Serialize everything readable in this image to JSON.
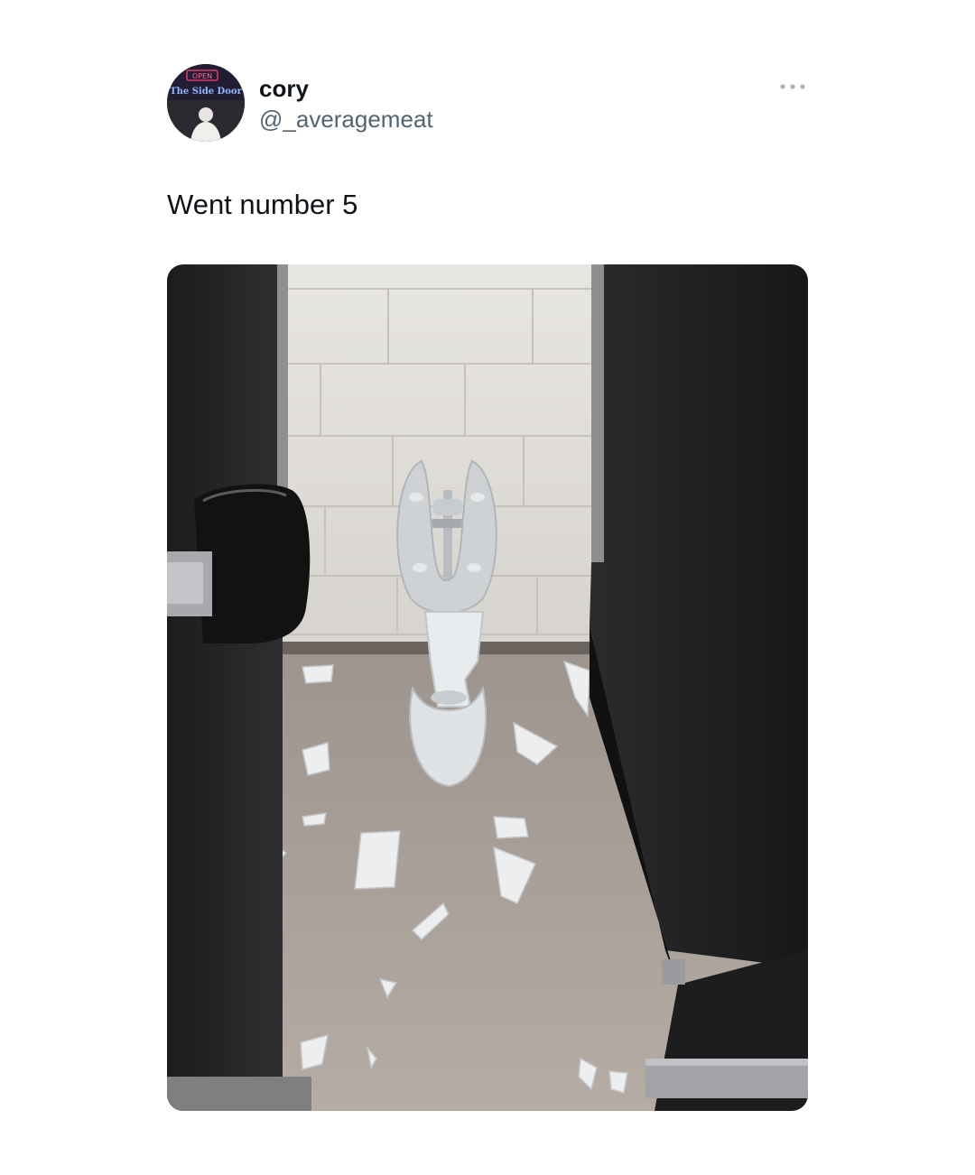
{
  "tweet": {
    "author": {
      "name": "cory",
      "handle": "@_averagemeat",
      "avatar_sign": {
        "open": "OPEN",
        "name": "The Side Door"
      }
    },
    "more_icon": "more-horizontal-icon",
    "text": "Went number 5",
    "media": {
      "kind": "photo"
    }
  },
  "colors": {
    "text_primary": "#0f1419",
    "text_secondary": "#536471",
    "background": "#ffffff"
  }
}
